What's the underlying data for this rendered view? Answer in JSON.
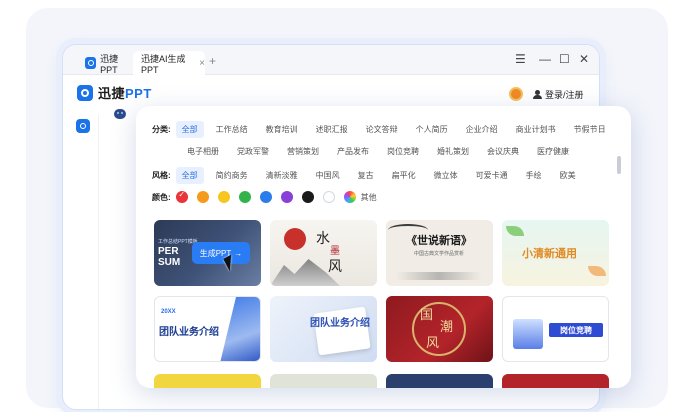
{
  "tabs": {
    "home_label": "迅捷PPT",
    "active_label": "迅捷AI生成PPT",
    "close_symbol": "×",
    "add_symbol": "+"
  },
  "window_controls": {
    "menu": "☰",
    "minimize": "—",
    "maximize": "☐",
    "close": "✕"
  },
  "header": {
    "brand_prefix": "迅捷",
    "brand_suffix": "PPT",
    "login_label": "登录/注册"
  },
  "filters": {
    "category_label": "分类:",
    "categories_row1": [
      "全部",
      "工作总结",
      "教育培训",
      "述职汇报",
      "论文答辩",
      "个人简历",
      "企业介绍",
      "商业计划书",
      "节假节日"
    ],
    "categories_row2": [
      "电子相册",
      "党政军警",
      "营销策划",
      "产品发布",
      "岗位竞聘",
      "婚礼策划",
      "会议庆典",
      "医疗健康"
    ],
    "style_label": "风格:",
    "styles": [
      "全部",
      "简约商务",
      "清新淡雅",
      "中国风",
      "复古",
      "扁平化",
      "微立体",
      "可爱卡通",
      "手绘",
      "欧美"
    ],
    "color_label": "颜色:",
    "color_check": "✓",
    "colors": [
      "#e8343a",
      "#f59a1b",
      "#f7c61f",
      "#33b34a",
      "#2b7de9",
      "#8a3fd6",
      "#1a1a1a",
      "#ffffff"
    ],
    "color_other_label": "其他"
  },
  "templates": [
    {
      "title": "工作总结PPT模板",
      "subtitle": "PER",
      "subtitle2": "SUM",
      "overlay_button": "生成PPT",
      "arrow": "→"
    },
    {
      "title": "水",
      "title2": "墨",
      "title3": "风"
    },
    {
      "title": "《世说新语》",
      "subtitle": "中国古典文学作品赏析"
    },
    {
      "title": "小清新通用"
    },
    {
      "title": "团队业务介绍",
      "code": "20XX"
    },
    {
      "title": "团队业务介绍"
    },
    {
      "title": "国",
      "title2": "潮",
      "title3": "风"
    },
    {
      "title": "岗位竞聘"
    }
  ],
  "row3_colors": [
    "#f2d640",
    "#dfe3d8",
    "#2a3f6e",
    "#b3242a"
  ]
}
